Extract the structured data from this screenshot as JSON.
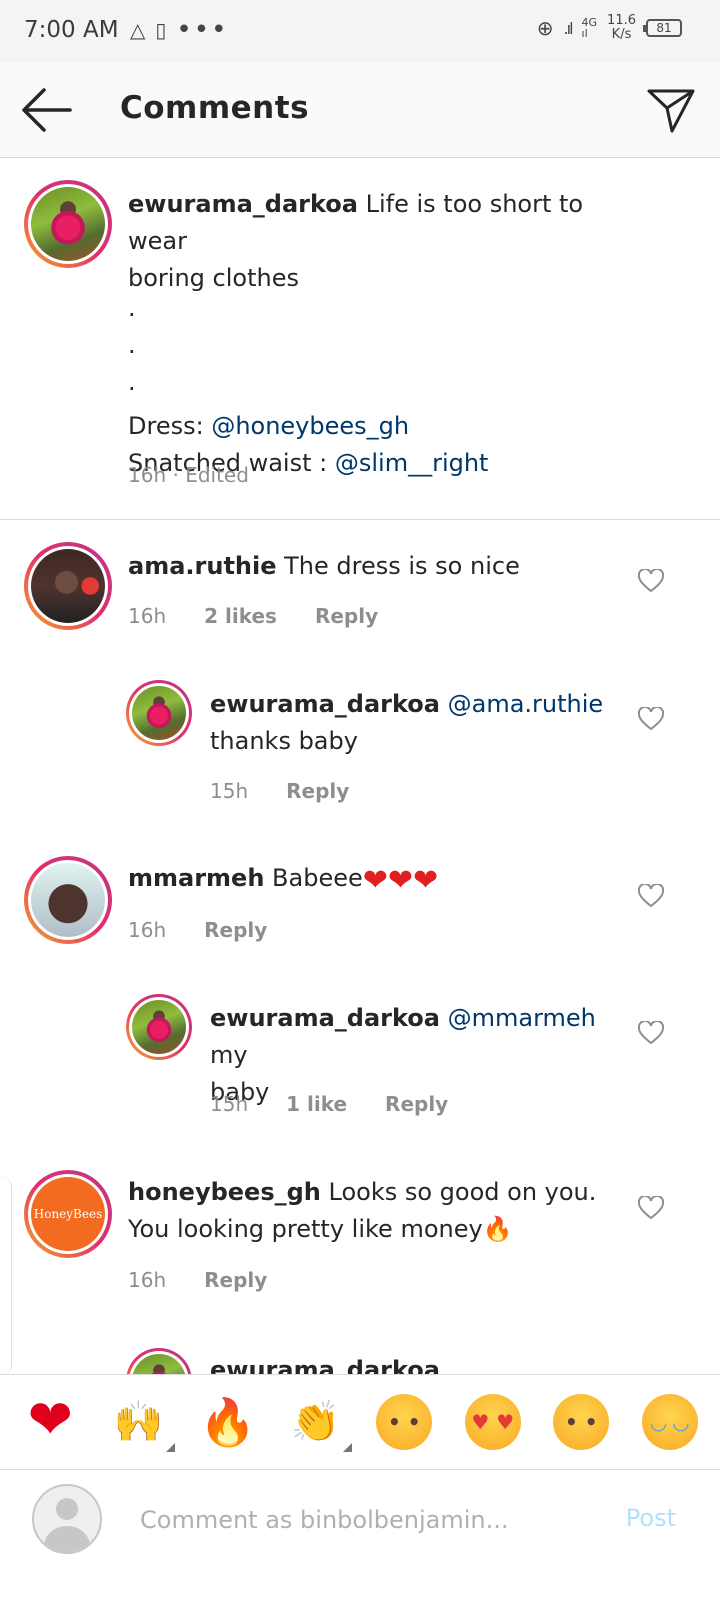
{
  "status_bar": {
    "time": "7:00 AM",
    "network": "4G",
    "speed": "11.6",
    "speed_unit": "K/s",
    "battery": "81"
  },
  "header": {
    "title": "Comments"
  },
  "caption": {
    "username": "ewurama_darkoa",
    "text_line1": " Life is too short to wear",
    "text_line2": "boring clothes",
    "dots": [
      "·",
      "·",
      "·"
    ],
    "dress_label": "Dress: ",
    "dress_mention": "@honeybees_gh",
    "waist_label": "Snatched waist : ",
    "waist_mention": "@slim__right",
    "meta": "16h · Edited"
  },
  "comments": [
    {
      "username": "ama.ruthie",
      "text": " The dress is so nice",
      "time": "16h",
      "likes": "2 likes",
      "reply": "Reply"
    },
    {
      "username": "ewurama_darkoa",
      "mention": " @ama.ruthie",
      "text": "thanks baby",
      "time": "15h",
      "reply": "Reply"
    },
    {
      "username": "mmarmeh",
      "text": " Babeee",
      "time": "16h",
      "reply": "Reply"
    },
    {
      "username": "ewurama_darkoa",
      "mention": " @mmarmeh",
      "text_tail": " my",
      "text": "baby",
      "time": "15h",
      "likes": "1 like",
      "reply": "Reply"
    },
    {
      "username": "honeybees_gh",
      "text": " Looks so good on you.",
      "text_line2": "You looking pretty like money",
      "time": "16h",
      "reply": "Reply",
      "avatar_text": "HoneyBees"
    },
    {
      "username": "ewurama_darkoa"
    }
  ],
  "emoji_bar": [
    "heart",
    "raising-hands",
    "fire",
    "clapping-hands",
    "crying-face",
    "heart-eyes",
    "surprised-face",
    "tears-of-joy"
  ],
  "comment_box": {
    "placeholder": "Comment as binbolbenjamin...",
    "post_label": "Post"
  },
  "colors": {
    "mention": "#00376b",
    "meta": "#8e8e8e",
    "post_disabled": "#b2dffc",
    "story_ring_start": "#f9a825",
    "story_ring_end": "#c13584"
  }
}
